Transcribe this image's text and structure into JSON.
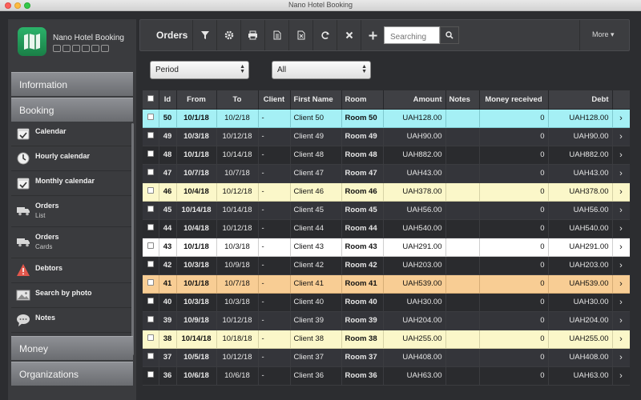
{
  "window": {
    "title": "Nano Hotel Booking"
  },
  "app": {
    "name": "Nano Hotel Booking"
  },
  "sidebar": {
    "sections": {
      "information": "Information",
      "booking": "Booking",
      "money": "Money",
      "organizations": "Organizations"
    },
    "items": [
      {
        "label": "Calendar",
        "sub": "",
        "icon": "calendar-icon"
      },
      {
        "label": "Hourly calendar",
        "sub": "",
        "icon": "clock-icon"
      },
      {
        "label": "Monthly calendar",
        "sub": "",
        "icon": "calendar-check-icon"
      },
      {
        "label": "Orders",
        "sub": "List",
        "icon": "truck-icon"
      },
      {
        "label": "Orders",
        "sub": "Cards",
        "icon": "truck-icon"
      },
      {
        "label": "Debtors",
        "sub": "",
        "icon": "warning-icon"
      },
      {
        "label": "Search by photo",
        "sub": "",
        "icon": "image-icon"
      },
      {
        "label": "Notes",
        "sub": "",
        "icon": "speech-bubble-icon"
      }
    ]
  },
  "toolbar": {
    "title": "Orders",
    "search_placeholder": "Searching",
    "more": "More ▾"
  },
  "filters": {
    "period": "Period",
    "status": "All"
  },
  "table": {
    "columns": [
      "Id",
      "From",
      "To",
      "Client",
      "First Name",
      "Room",
      "Amount",
      "Notes",
      "Money received",
      "Debt"
    ],
    "rows": [
      {
        "id": "50",
        "from": "10/1/18",
        "to": "10/2/18",
        "client": "-",
        "first_name": "Client 50",
        "room": "Room 50",
        "amount": "UAH128.00",
        "notes": "",
        "received": "0",
        "debt": "UAH128.00",
        "style": "cyan"
      },
      {
        "id": "49",
        "from": "10/3/18",
        "to": "10/12/18",
        "client": "-",
        "first_name": "Client 49",
        "room": "Room 49",
        "amount": "UAH90.00",
        "notes": "",
        "received": "0",
        "debt": "UAH90.00",
        "style": "alt"
      },
      {
        "id": "48",
        "from": "10/1/18",
        "to": "10/14/18",
        "client": "-",
        "first_name": "Client 48",
        "room": "Room 48",
        "amount": "UAH882.00",
        "notes": "",
        "received": "0",
        "debt": "UAH882.00",
        "style": "dark"
      },
      {
        "id": "47",
        "from": "10/7/18",
        "to": "10/7/18",
        "client": "-",
        "first_name": "Client 47",
        "room": "Room 47",
        "amount": "UAH43.00",
        "notes": "",
        "received": "0",
        "debt": "UAH43.00",
        "style": "alt"
      },
      {
        "id": "46",
        "from": "10/4/18",
        "to": "10/12/18",
        "client": "-",
        "first_name": "Client 46",
        "room": "Room 46",
        "amount": "UAH378.00",
        "notes": "",
        "received": "0",
        "debt": "UAH378.00",
        "style": "yellow"
      },
      {
        "id": "45",
        "from": "10/14/18",
        "to": "10/14/18",
        "client": "-",
        "first_name": "Client 45",
        "room": "Room 45",
        "amount": "UAH56.00",
        "notes": "",
        "received": "0",
        "debt": "UAH56.00",
        "style": "alt"
      },
      {
        "id": "44",
        "from": "10/4/18",
        "to": "10/12/18",
        "client": "-",
        "first_name": "Client 44",
        "room": "Room 44",
        "amount": "UAH540.00",
        "notes": "",
        "received": "0",
        "debt": "UAH540.00",
        "style": "dark"
      },
      {
        "id": "43",
        "from": "10/1/18",
        "to": "10/3/18",
        "client": "-",
        "first_name": "Client 43",
        "room": "Room 43",
        "amount": "UAH291.00",
        "notes": "",
        "received": "0",
        "debt": "UAH291.00",
        "style": "white"
      },
      {
        "id": "42",
        "from": "10/3/18",
        "to": "10/9/18",
        "client": "-",
        "first_name": "Client 42",
        "room": "Room 42",
        "amount": "UAH203.00",
        "notes": "",
        "received": "0",
        "debt": "UAH203.00",
        "style": "dark"
      },
      {
        "id": "41",
        "from": "10/1/18",
        "to": "10/7/18",
        "client": "-",
        "first_name": "Client 41",
        "room": "Room 41",
        "amount": "UAH539.00",
        "notes": "",
        "received": "0",
        "debt": "UAH539.00",
        "style": "orange"
      },
      {
        "id": "40",
        "from": "10/3/18",
        "to": "10/3/18",
        "client": "-",
        "first_name": "Client 40",
        "room": "Room 40",
        "amount": "UAH30.00",
        "notes": "",
        "received": "0",
        "debt": "UAH30.00",
        "style": "dark"
      },
      {
        "id": "39",
        "from": "10/9/18",
        "to": "10/12/18",
        "client": "-",
        "first_name": "Client 39",
        "room": "Room 39",
        "amount": "UAH204.00",
        "notes": "",
        "received": "0",
        "debt": "UAH204.00",
        "style": "alt"
      },
      {
        "id": "38",
        "from": "10/14/18",
        "to": "10/18/18",
        "client": "-",
        "first_name": "Client 38",
        "room": "Room 38",
        "amount": "UAH255.00",
        "notes": "",
        "received": "0",
        "debt": "UAH255.00",
        "style": "yellow"
      },
      {
        "id": "37",
        "from": "10/5/18",
        "to": "10/12/18",
        "client": "-",
        "first_name": "Client 37",
        "room": "Room 37",
        "amount": "UAH408.00",
        "notes": "",
        "received": "0",
        "debt": "UAH408.00",
        "style": "alt"
      },
      {
        "id": "36",
        "from": "10/6/18",
        "to": "10/6/18",
        "client": "-",
        "first_name": "Client 36",
        "room": "Room 36",
        "amount": "UAH63.00",
        "notes": "",
        "received": "0",
        "debt": "UAH63.00",
        "style": "dark"
      }
    ]
  }
}
